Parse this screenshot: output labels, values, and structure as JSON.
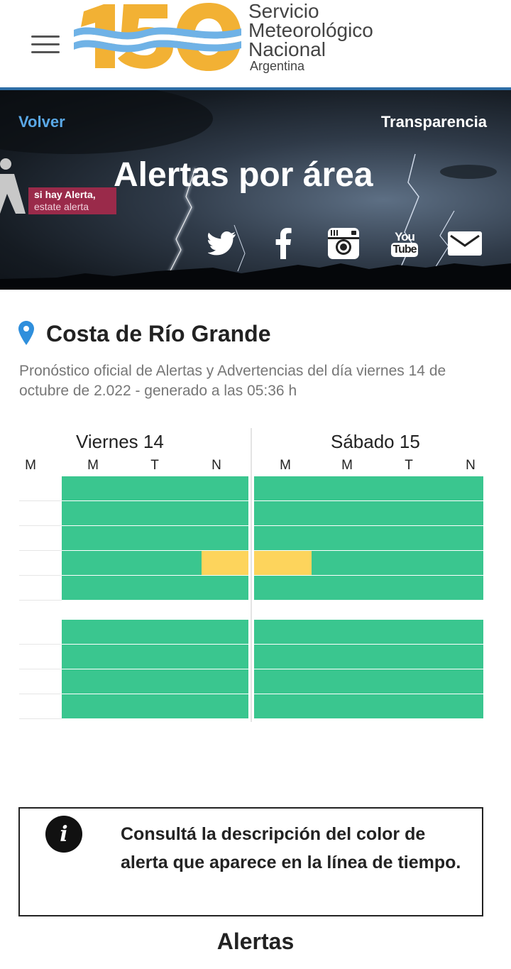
{
  "header": {
    "logo_number": "150",
    "org_lines": [
      "Servicio",
      "Meteorológico",
      "Nacional"
    ],
    "org_country": "Argentina",
    "colors": {
      "logo_gold": "#f2b134",
      "logo_blue": "#6fb2e6",
      "rule": "#2e6ea6"
    }
  },
  "banner": {
    "back_label": "Volver",
    "transparency_label": "Transparencia",
    "title": "Alertas por área",
    "campaign_line1": "si hay Alerta,",
    "campaign_line2": "estate alerta",
    "social_icons": [
      "twitter-icon",
      "facebook-icon",
      "instagram-icon",
      "youtube-icon",
      "mail-icon"
    ],
    "youtube_you": "You",
    "youtube_tube": "Tube"
  },
  "location": {
    "name": "Costa de Río Grande",
    "description": "Pronóstico oficial de Alertas y Advertencias del día viernes 14 de octubre de 2.022 - generado a las 05:36 h"
  },
  "timeline": {
    "days": [
      "Viernes 14",
      "Sábado 15"
    ],
    "periods": [
      "M",
      "M",
      "T",
      "N",
      "M",
      "M",
      "T",
      "N"
    ],
    "colors": {
      "green": "#3ac68f",
      "yellow": "#fdd45c"
    },
    "group1_rows": [
      [
        "green",
        "green",
        "green",
        "green",
        "green",
        "green",
        "green",
        "green"
      ],
      [
        "green",
        "green",
        "green",
        "green",
        "green",
        "green",
        "green",
        "green"
      ],
      [
        "green",
        "green",
        "green",
        "green",
        "green",
        "green",
        "green",
        "green"
      ],
      [
        "green",
        "green",
        "green",
        "yellow",
        "yellow",
        "green",
        "green",
        "green"
      ],
      [
        "green",
        "green",
        "green",
        "green",
        "green",
        "green",
        "green",
        "green"
      ]
    ],
    "group2_rows": [
      [
        "green",
        "green",
        "green",
        "green",
        "green",
        "green",
        "green",
        "green"
      ],
      [
        "green",
        "green",
        "green",
        "green",
        "green",
        "green",
        "green",
        "green"
      ],
      [
        "green",
        "green",
        "green",
        "green",
        "green",
        "green",
        "green",
        "green"
      ],
      [
        "green",
        "green",
        "green",
        "green",
        "green",
        "green",
        "green",
        "green"
      ]
    ]
  },
  "info": {
    "text": "Consultá la descripción del color de alerta que aparece en la línea de tiempo."
  },
  "alerts_heading": "Alertas"
}
